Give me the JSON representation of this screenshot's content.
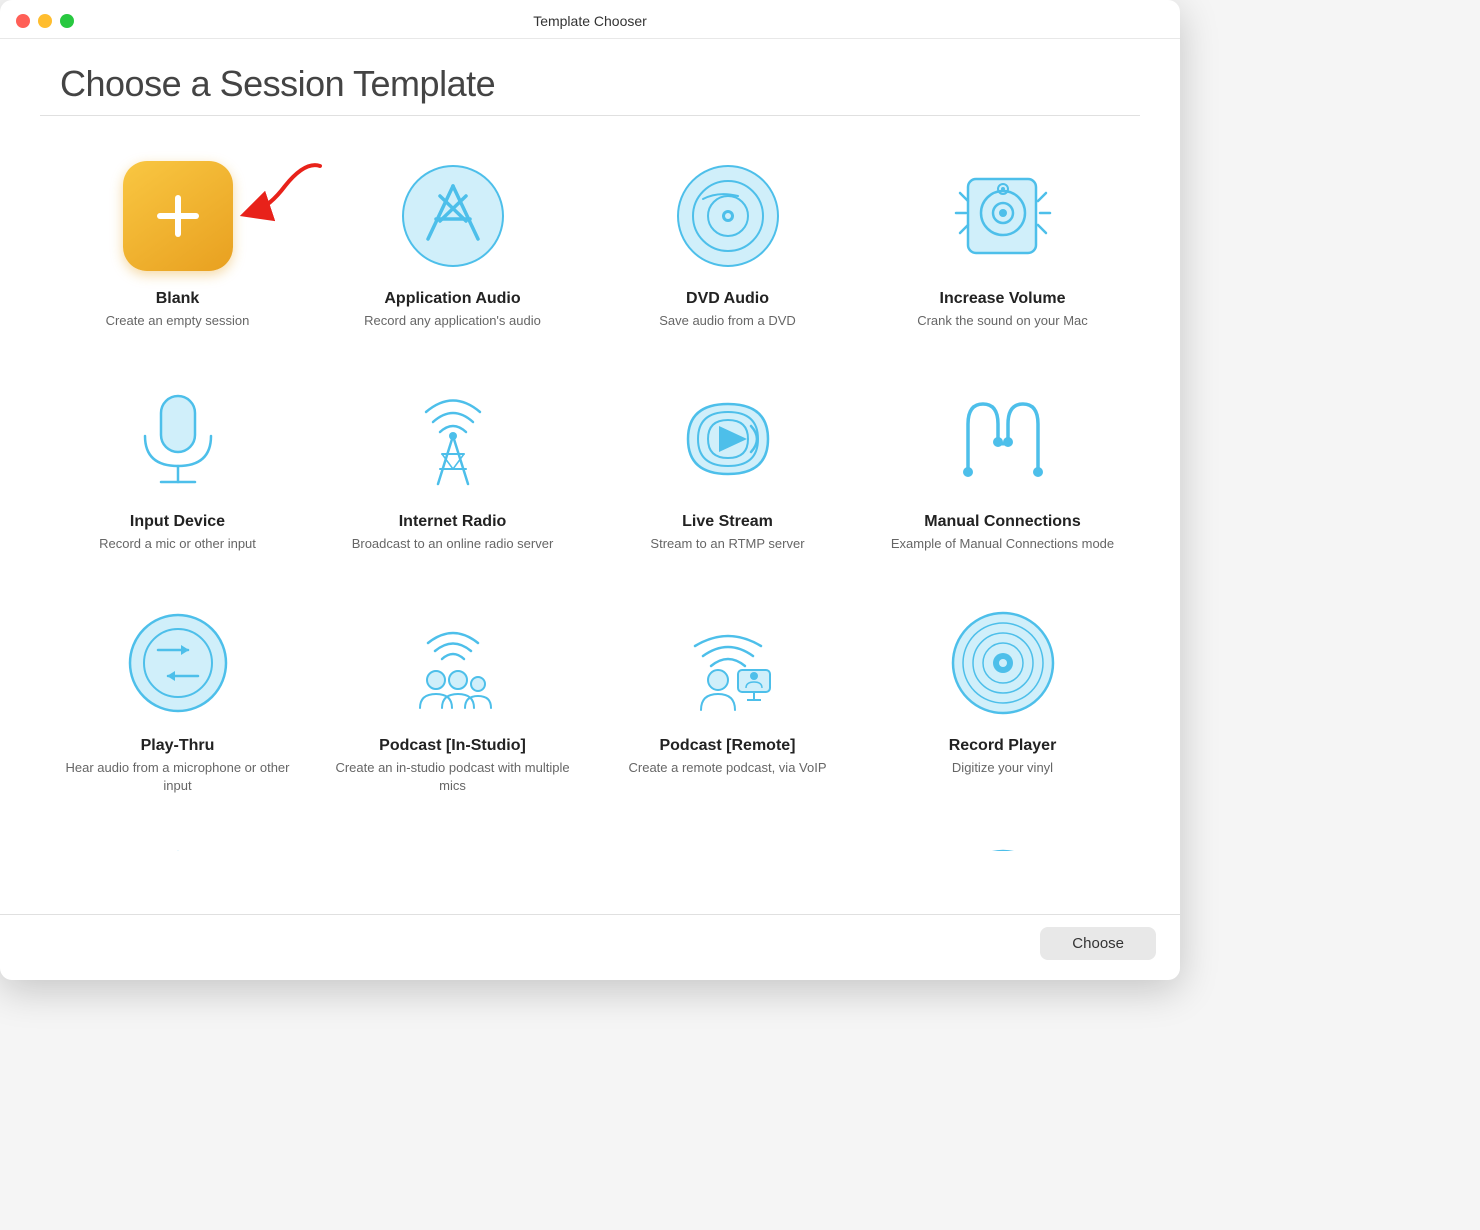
{
  "window": {
    "title": "Template Chooser"
  },
  "page": {
    "title": "Choose a Session Template"
  },
  "footer": {
    "choose_label": "Choose"
  },
  "templates": [
    {
      "id": "blank",
      "name": "Blank",
      "desc": "Create an empty session",
      "icon": "blank"
    },
    {
      "id": "application-audio",
      "name": "Application Audio",
      "desc": "Record any application's audio",
      "icon": "app-audio"
    },
    {
      "id": "dvd-audio",
      "name": "DVD Audio",
      "desc": "Save audio from a DVD",
      "icon": "dvd"
    },
    {
      "id": "increase-volume",
      "name": "Increase Volume",
      "desc": "Crank the sound on your Mac",
      "icon": "speaker"
    },
    {
      "id": "input-device",
      "name": "Input Device",
      "desc": "Record a mic or other input",
      "icon": "mic"
    },
    {
      "id": "internet-radio",
      "name": "Internet Radio",
      "desc": "Broadcast to an online radio server",
      "icon": "radio"
    },
    {
      "id": "live-stream",
      "name": "Live Stream",
      "desc": "Stream to an RTMP server",
      "icon": "stream"
    },
    {
      "id": "manual-connections",
      "name": "Manual Connections",
      "desc": "Example of Manual Connections mode",
      "icon": "manual"
    },
    {
      "id": "play-thru",
      "name": "Play-Thru",
      "desc": "Hear audio from a microphone or other input",
      "icon": "playthru"
    },
    {
      "id": "podcast-instudio",
      "name": "Podcast [In-Studio]",
      "desc": "Create an in-studio podcast with multiple mics",
      "icon": "podcast-studio"
    },
    {
      "id": "podcast-remote",
      "name": "Podcast [Remote]",
      "desc": "Create a remote podcast, via VoIP",
      "icon": "podcast-remote"
    },
    {
      "id": "record-player",
      "name": "Record Player",
      "desc": "Digitize your vinyl",
      "icon": "vinyl"
    },
    {
      "id": "partial1",
      "name": "",
      "desc": "",
      "icon": "partial-triangle"
    },
    {
      "id": "partial2",
      "name": "",
      "desc": "",
      "icon": "partial-headphones"
    },
    {
      "id": "partial3",
      "name": "",
      "desc": "",
      "icon": "partial-oval"
    },
    {
      "id": "partial4",
      "name": "",
      "desc": "",
      "icon": "partial-globe"
    }
  ]
}
